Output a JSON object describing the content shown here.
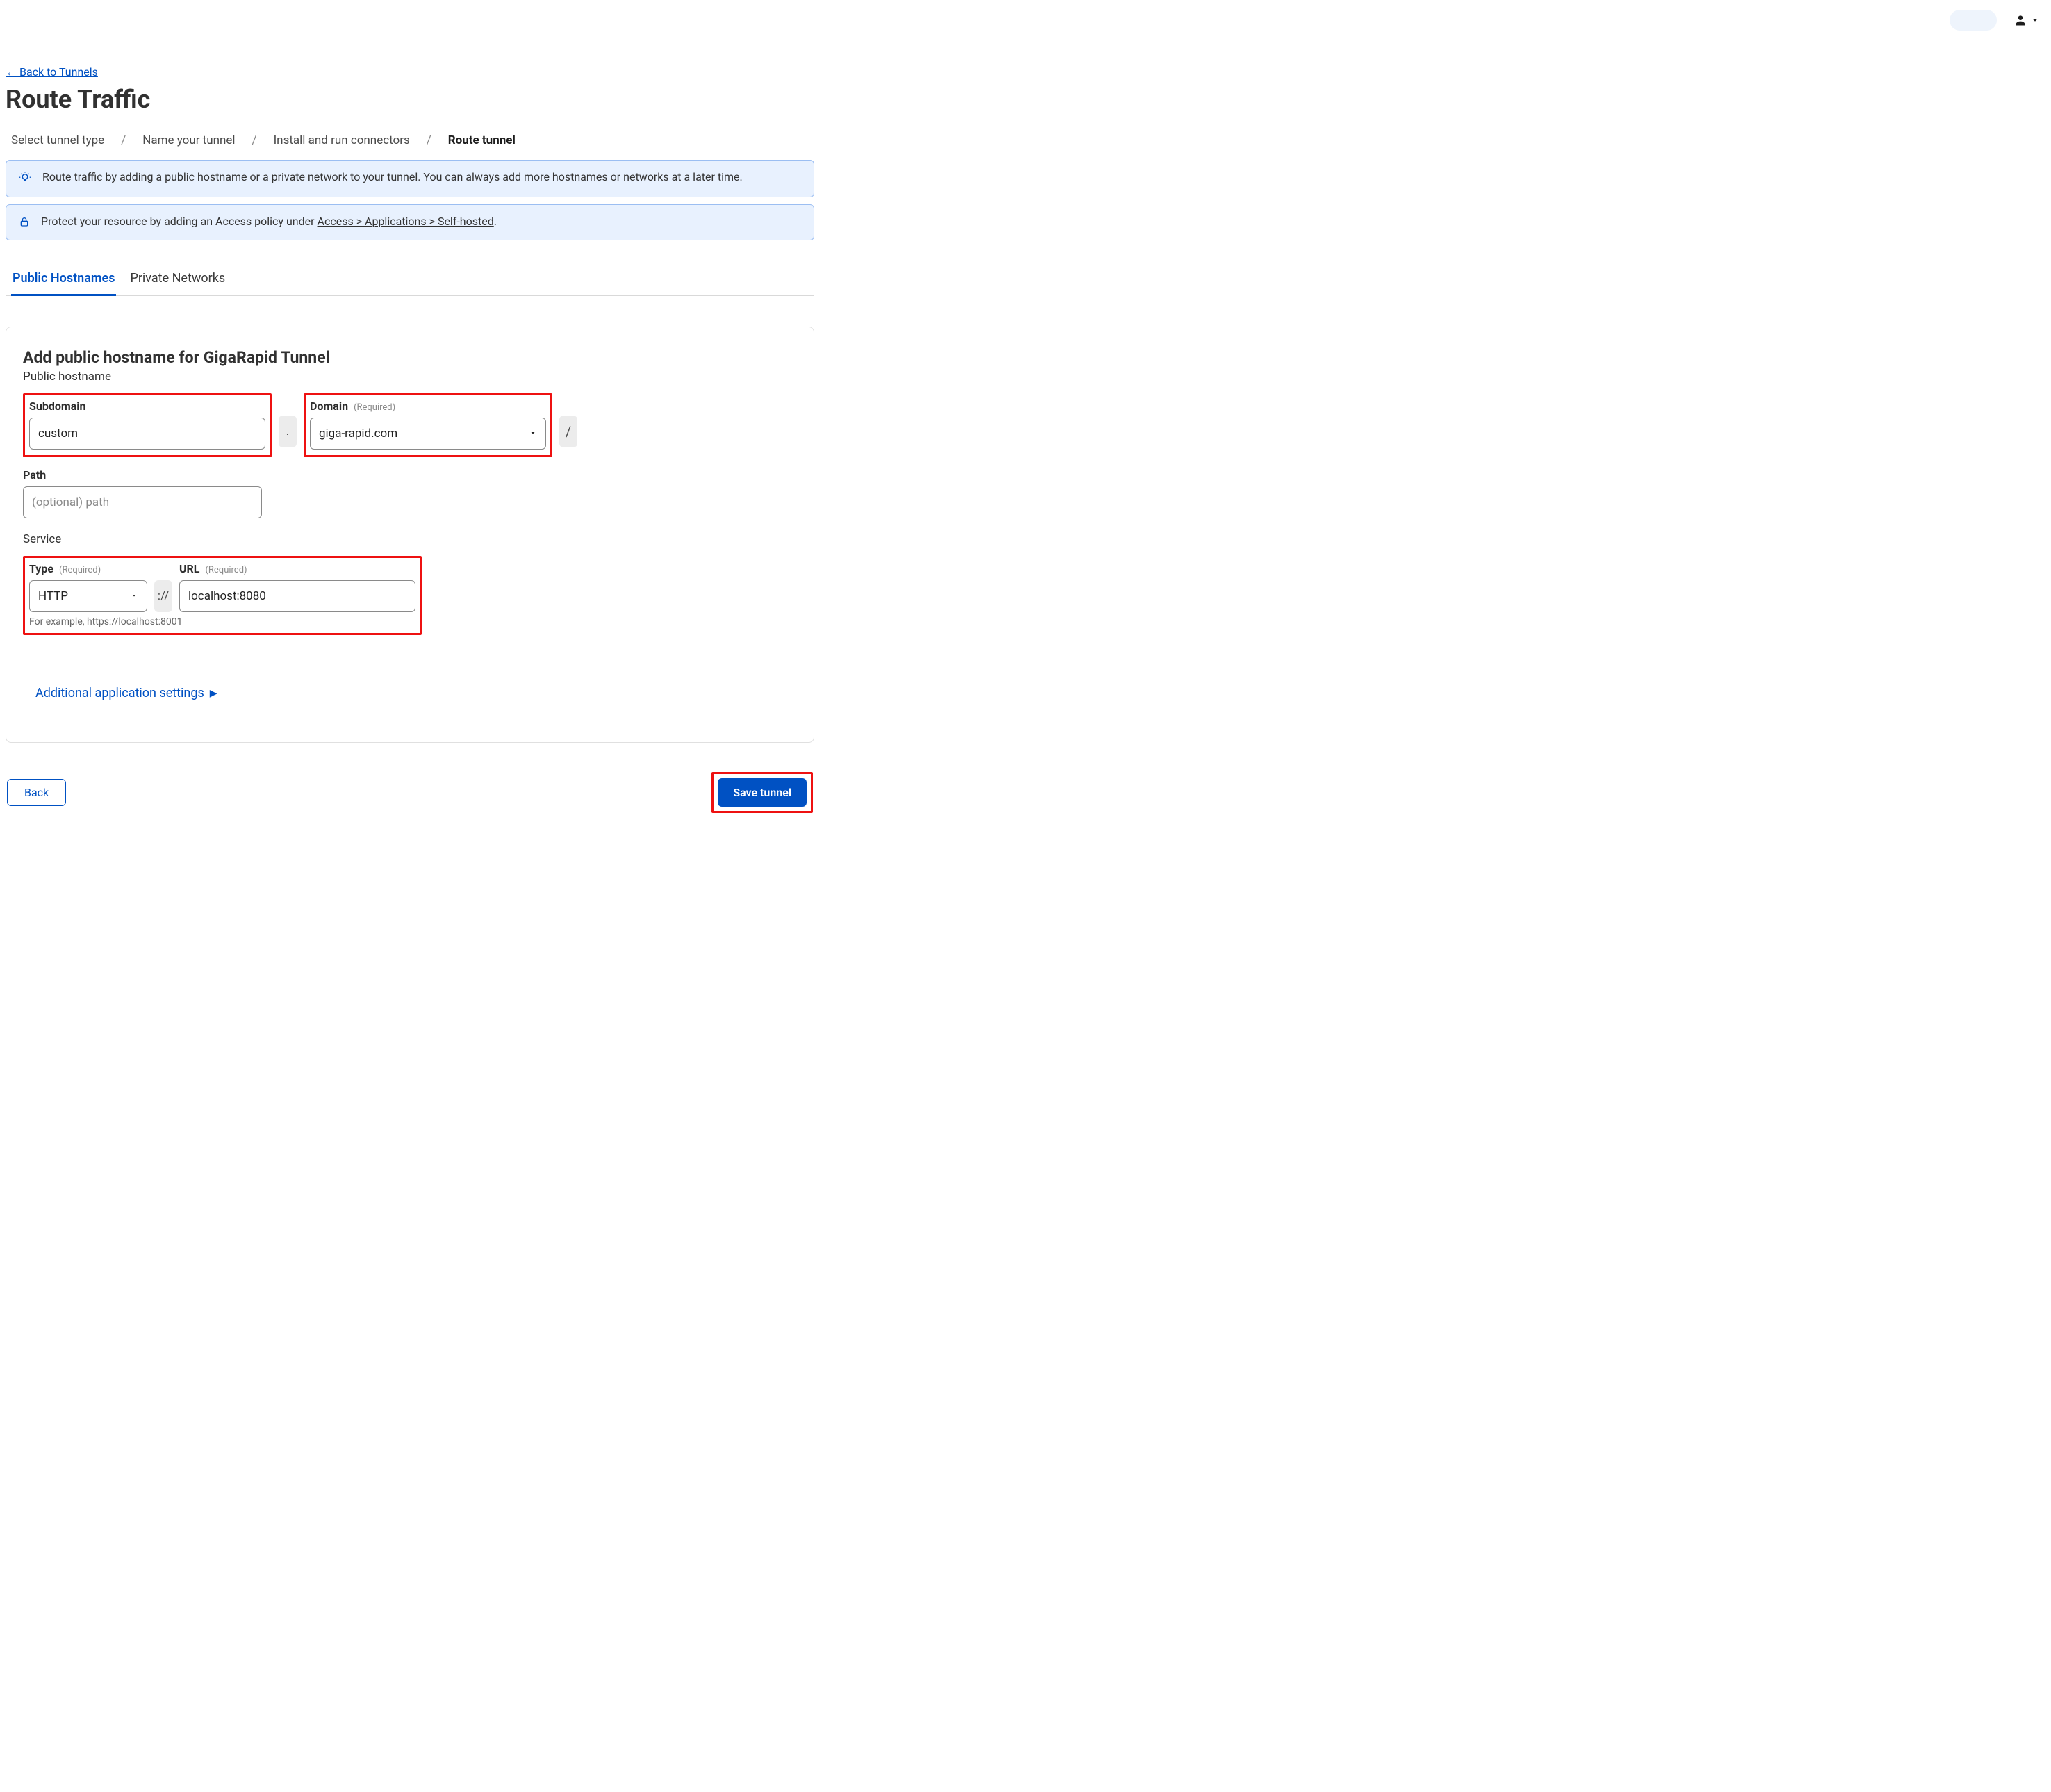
{
  "nav": {
    "back_label": "← Back to Tunnels"
  },
  "header": {
    "title": "Route Traffic",
    "crumbs": [
      "Select tunnel type",
      "Name your tunnel",
      "Install and run connectors",
      "Route tunnel"
    ],
    "active_crumb_index": 3
  },
  "info": {
    "route_text": "Route traffic by adding a public hostname or a private network to your tunnel. You can always add more hostnames or networks at a later time.",
    "protect_prefix": "Protect your resource by adding an Access policy under ",
    "protect_link": "Access > Applications > Self-hosted",
    "protect_suffix": "."
  },
  "tabs": {
    "public": "Public Hostnames",
    "private": "Private Networks"
  },
  "form": {
    "heading": "Add public hostname for GigaRapid Tunnel",
    "section_hostname": "Public hostname",
    "section_service": "Service",
    "required_tag": "(Required)",
    "subdomain_label": "Subdomain",
    "subdomain_value": "custom",
    "domain_label": "Domain",
    "domain_value": "giga-rapid.com",
    "path_label": "Path",
    "path_placeholder": "(optional) path",
    "type_label": "Type",
    "type_value": "HTTP",
    "url_label": "URL",
    "url_value": "localhost:8080",
    "service_helper": "For example, https://localhost:8001",
    "dot": ".",
    "slash": "/",
    "proto_sep": "://",
    "advanced": "Additional application settings"
  },
  "buttons": {
    "back": "Back",
    "save": "Save tunnel"
  }
}
